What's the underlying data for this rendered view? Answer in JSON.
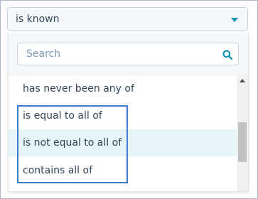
{
  "select": {
    "value": "is known"
  },
  "search": {
    "placeholder": "Search"
  },
  "options": [
    {
      "label": "has never been any of"
    },
    {
      "label": "is equal to all of"
    },
    {
      "label": "is not equal to all of"
    },
    {
      "label": "contains all of"
    }
  ],
  "colors": {
    "accent": "#0091ae",
    "text": "#33475b",
    "placeholder": "#7c98b6",
    "hover_bg": "#e5f5f8",
    "highlight_border": "#3d7ac9"
  },
  "icons": {
    "caret": "caret-down-icon",
    "search": "search-icon",
    "scroll_up": "scroll-up-arrow-icon"
  }
}
